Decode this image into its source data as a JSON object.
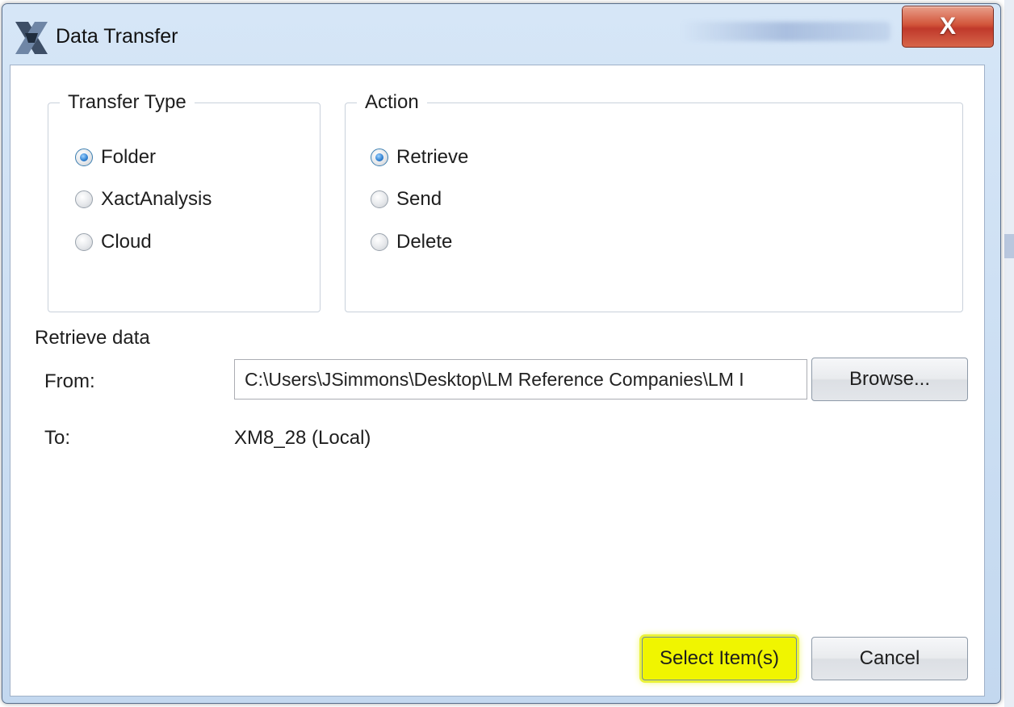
{
  "window": {
    "title": "Data Transfer",
    "close_label": "X"
  },
  "transfer_type": {
    "legend": "Transfer Type",
    "options": [
      {
        "label": "Folder",
        "checked": true
      },
      {
        "label": "XactAnalysis",
        "checked": false
      },
      {
        "label": "Cloud",
        "checked": false
      }
    ]
  },
  "action": {
    "legend": "Action",
    "options": [
      {
        "label": "Retrieve",
        "checked": true
      },
      {
        "label": "Send",
        "checked": false
      },
      {
        "label": "Delete",
        "checked": false
      }
    ]
  },
  "retrieve": {
    "section_label": "Retrieve data",
    "from_label": "From:",
    "from_value": "C:\\Users\\JSimmons\\Desktop\\LM Reference Companies\\LM I",
    "browse_label": "Browse...",
    "to_label": "To:",
    "to_value": "XM8_28 (Local)"
  },
  "footer": {
    "select_items_label": "Select Item(s)",
    "cancel_label": "Cancel",
    "highlight_color": "#f0f500"
  }
}
